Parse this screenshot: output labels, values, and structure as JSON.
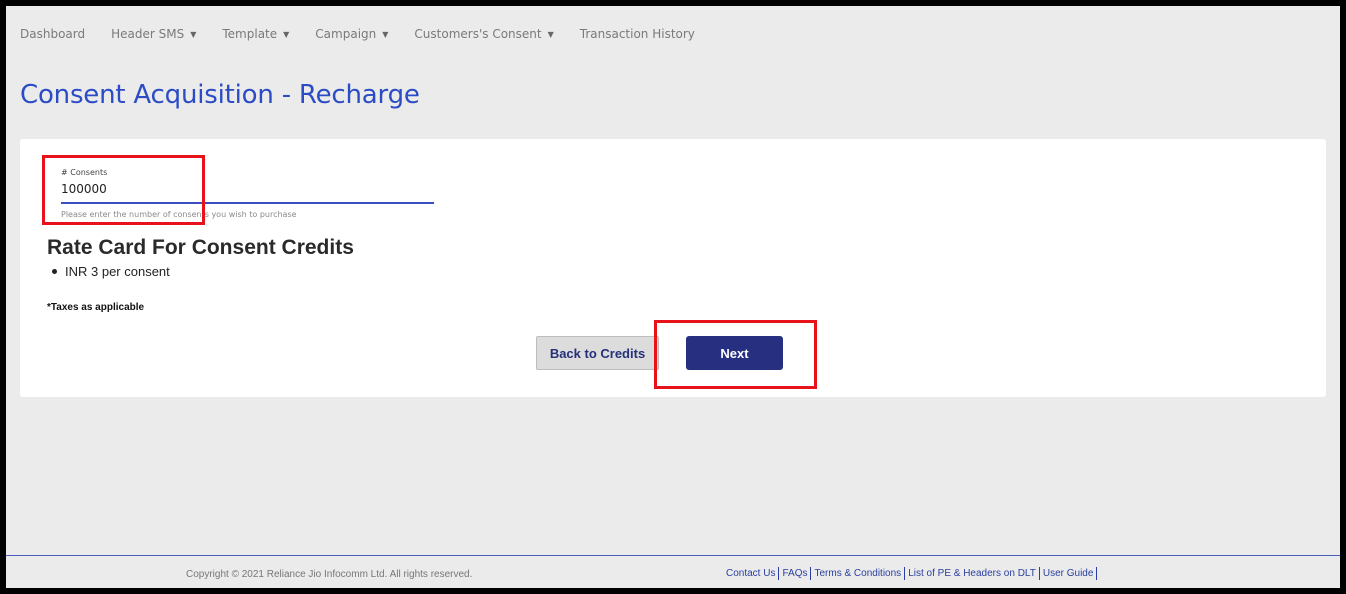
{
  "nav": {
    "items": [
      {
        "label": "Dashboard",
        "has_dropdown": false
      },
      {
        "label": "Header SMS",
        "has_dropdown": true
      },
      {
        "label": "Template",
        "has_dropdown": true
      },
      {
        "label": "Campaign",
        "has_dropdown": true
      },
      {
        "label": "Customers's Consent",
        "has_dropdown": true
      },
      {
        "label": "Transaction History",
        "has_dropdown": false
      }
    ],
    "caret_glyph": "▼"
  },
  "page": {
    "title": "Consent Acquisition - Recharge"
  },
  "form": {
    "consents_label": "# Consents",
    "consents_value": "100000",
    "consents_help": "Please enter the number of consents you wish to purchase"
  },
  "rate_card": {
    "title": "Rate Card For Consent Credits",
    "items": [
      "INR 3 per consent"
    ],
    "taxes_note": "*Taxes as applicable"
  },
  "buttons": {
    "back_label": "Back to Credits",
    "next_label": "Next"
  },
  "footer": {
    "copyright": "Copyright © 2021 Reliance Jio Infocomm Ltd. All rights reserved.",
    "links": [
      "Contact Us",
      "FAQs",
      "Terms & Conditions",
      "List of PE & Headers on DLT",
      "User Guide"
    ]
  },
  "colors": {
    "title_blue": "#2b4cc4",
    "primary_button": "#262f80",
    "highlight_red": "#e8121b",
    "background": "#ebebeb"
  }
}
